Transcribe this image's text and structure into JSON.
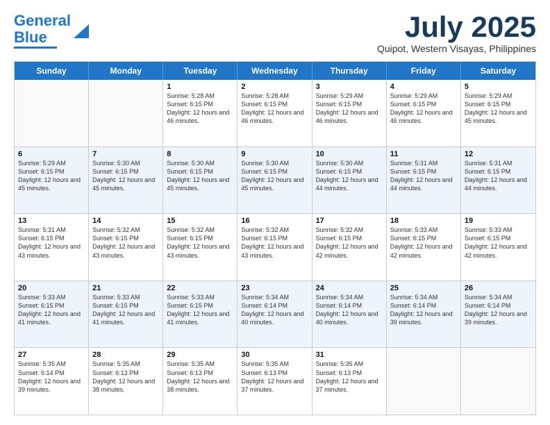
{
  "logo": {
    "line1": "General",
    "line2": "Blue"
  },
  "header": {
    "month": "July 2025",
    "location": "Quipot, Western Visayas, Philippines"
  },
  "days_of_week": [
    "Sunday",
    "Monday",
    "Tuesday",
    "Wednesday",
    "Thursday",
    "Friday",
    "Saturday"
  ],
  "weeks": [
    [
      {
        "day": "",
        "info": ""
      },
      {
        "day": "",
        "info": ""
      },
      {
        "day": "1",
        "info": "Sunrise: 5:28 AM\nSunset: 6:15 PM\nDaylight: 12 hours and 46 minutes."
      },
      {
        "day": "2",
        "info": "Sunrise: 5:28 AM\nSunset: 6:15 PM\nDaylight: 12 hours and 46 minutes."
      },
      {
        "day": "3",
        "info": "Sunrise: 5:29 AM\nSunset: 6:15 PM\nDaylight: 12 hours and 46 minutes."
      },
      {
        "day": "4",
        "info": "Sunrise: 5:29 AM\nSunset: 6:15 PM\nDaylight: 12 hours and 46 minutes."
      },
      {
        "day": "5",
        "info": "Sunrise: 5:29 AM\nSunset: 6:15 PM\nDaylight: 12 hours and 45 minutes."
      }
    ],
    [
      {
        "day": "6",
        "info": "Sunrise: 5:29 AM\nSunset: 6:15 PM\nDaylight: 12 hours and 45 minutes."
      },
      {
        "day": "7",
        "info": "Sunrise: 5:30 AM\nSunset: 6:15 PM\nDaylight: 12 hours and 45 minutes."
      },
      {
        "day": "8",
        "info": "Sunrise: 5:30 AM\nSunset: 6:15 PM\nDaylight: 12 hours and 45 minutes."
      },
      {
        "day": "9",
        "info": "Sunrise: 5:30 AM\nSunset: 6:15 PM\nDaylight: 12 hours and 45 minutes."
      },
      {
        "day": "10",
        "info": "Sunrise: 5:30 AM\nSunset: 6:15 PM\nDaylight: 12 hours and 44 minutes."
      },
      {
        "day": "11",
        "info": "Sunrise: 5:31 AM\nSunset: 6:15 PM\nDaylight: 12 hours and 44 minutes."
      },
      {
        "day": "12",
        "info": "Sunrise: 5:31 AM\nSunset: 6:15 PM\nDaylight: 12 hours and 44 minutes."
      }
    ],
    [
      {
        "day": "13",
        "info": "Sunrise: 5:31 AM\nSunset: 6:15 PM\nDaylight: 12 hours and 43 minutes."
      },
      {
        "day": "14",
        "info": "Sunrise: 5:32 AM\nSunset: 6:15 PM\nDaylight: 12 hours and 43 minutes."
      },
      {
        "day": "15",
        "info": "Sunrise: 5:32 AM\nSunset: 6:15 PM\nDaylight: 12 hours and 43 minutes."
      },
      {
        "day": "16",
        "info": "Sunrise: 5:32 AM\nSunset: 6:15 PM\nDaylight: 12 hours and 43 minutes."
      },
      {
        "day": "17",
        "info": "Sunrise: 5:32 AM\nSunset: 6:15 PM\nDaylight: 12 hours and 42 minutes."
      },
      {
        "day": "18",
        "info": "Sunrise: 5:33 AM\nSunset: 6:15 PM\nDaylight: 12 hours and 42 minutes."
      },
      {
        "day": "19",
        "info": "Sunrise: 5:33 AM\nSunset: 6:15 PM\nDaylight: 12 hours and 42 minutes."
      }
    ],
    [
      {
        "day": "20",
        "info": "Sunrise: 5:33 AM\nSunset: 6:15 PM\nDaylight: 12 hours and 41 minutes."
      },
      {
        "day": "21",
        "info": "Sunrise: 5:33 AM\nSunset: 6:15 PM\nDaylight: 12 hours and 41 minutes."
      },
      {
        "day": "22",
        "info": "Sunrise: 5:33 AM\nSunset: 6:15 PM\nDaylight: 12 hours and 41 minutes."
      },
      {
        "day": "23",
        "info": "Sunrise: 5:34 AM\nSunset: 6:14 PM\nDaylight: 12 hours and 40 minutes."
      },
      {
        "day": "24",
        "info": "Sunrise: 5:34 AM\nSunset: 6:14 PM\nDaylight: 12 hours and 40 minutes."
      },
      {
        "day": "25",
        "info": "Sunrise: 5:34 AM\nSunset: 6:14 PM\nDaylight: 12 hours and 39 minutes."
      },
      {
        "day": "26",
        "info": "Sunrise: 5:34 AM\nSunset: 6:14 PM\nDaylight: 12 hours and 39 minutes."
      }
    ],
    [
      {
        "day": "27",
        "info": "Sunrise: 5:35 AM\nSunset: 6:14 PM\nDaylight: 12 hours and 39 minutes."
      },
      {
        "day": "28",
        "info": "Sunrise: 5:35 AM\nSunset: 6:13 PM\nDaylight: 12 hours and 38 minutes."
      },
      {
        "day": "29",
        "info": "Sunrise: 5:35 AM\nSunset: 6:13 PM\nDaylight: 12 hours and 38 minutes."
      },
      {
        "day": "30",
        "info": "Sunrise: 5:35 AM\nSunset: 6:13 PM\nDaylight: 12 hours and 37 minutes."
      },
      {
        "day": "31",
        "info": "Sunrise: 5:35 AM\nSunset: 6:13 PM\nDaylight: 12 hours and 37 minutes."
      },
      {
        "day": "",
        "info": ""
      },
      {
        "day": "",
        "info": ""
      }
    ]
  ]
}
